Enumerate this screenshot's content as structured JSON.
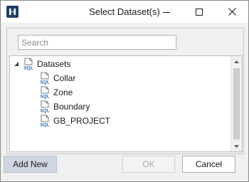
{
  "window": {
    "title": "Select Dataset(s)",
    "controls": [
      "minimize-icon",
      "maximize-icon",
      "close-icon"
    ]
  },
  "search": {
    "placeholder": "Search",
    "value": ""
  },
  "tree": {
    "root": {
      "label": "Datasets",
      "icon": "sql-file-icon",
      "expanded": true
    },
    "children": [
      {
        "label": "Collar",
        "icon": "sql-file-icon"
      },
      {
        "label": "Zone",
        "icon": "sql-file-icon"
      },
      {
        "label": "Boundary",
        "icon": "sql-file-icon"
      },
      {
        "label": "GB_PROJECT",
        "icon": "sql-file-icon"
      }
    ]
  },
  "buttons": {
    "add_new": "Add New",
    "ok": "OK",
    "cancel": "Cancel"
  },
  "colors": {
    "accent": "#1f3f66",
    "icon_blue": "#1f6fb5",
    "add_button_bg": "#cfd6e3"
  }
}
